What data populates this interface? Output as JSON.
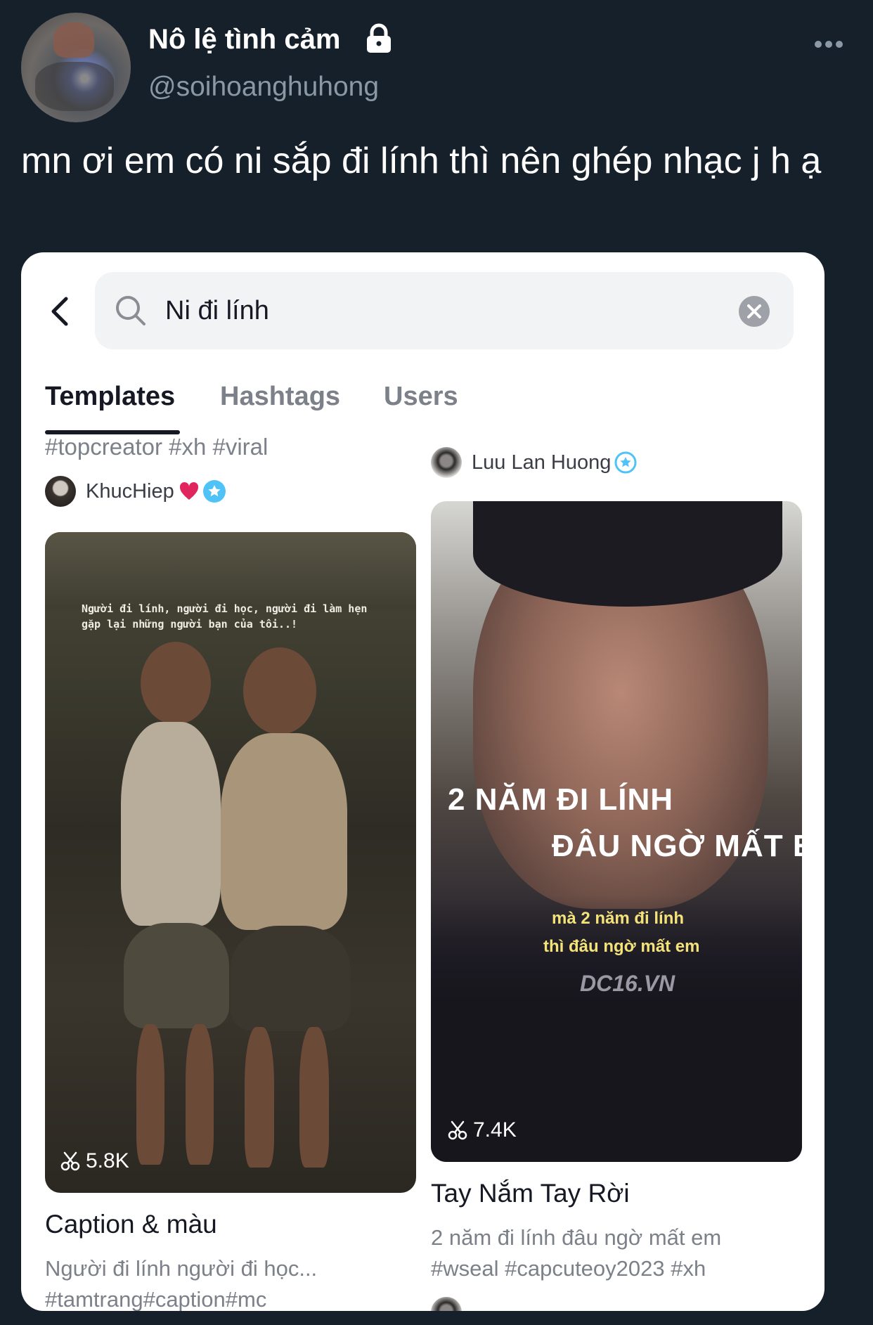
{
  "tweet": {
    "author_name": "Nô lệ tình cảm",
    "author_handle": "@soihoanghuhong",
    "text": "mn ơi em có ni sắp đi lính thì nên ghép nhạc j h ạ"
  },
  "embedded_app": {
    "search": {
      "value": "Ni đi lính"
    },
    "tabs": [
      {
        "label": "Templates",
        "active": true
      },
      {
        "label": "Hashtags",
        "active": false
      },
      {
        "label": "Users",
        "active": false
      }
    ],
    "results": {
      "left": {
        "top_hashtags": "#topcreator #xh #viral",
        "creator": "KhucHiep",
        "use_count": "5.8K",
        "thumbnail_caption": "Người đi lính, người đi học, người đi làm hẹn gặp lại những người bạn của tôi..!",
        "title": "Caption & màu",
        "desc_line1": "Người đi lính người đi học...",
        "desc_line2": "#tamtrang#caption#mc"
      },
      "right": {
        "creator": "Luu Lan Huong",
        "thumbnail_overlay": {
          "line1": "2 NĂM ĐI LÍNH",
          "line2": "ĐÂU NGỜ MẤT EM",
          "line3": "mà 2 năm đi lính",
          "line4": "thì đâu ngờ mất em",
          "watermark": "DC16.VN"
        },
        "use_count": "7.4K",
        "title": "Tay Nắm Tay Rời",
        "desc_line1": "2 năm đi lính đâu ngờ mất em",
        "desc_line2": "#wseal #capcuteoy2023 #xh"
      }
    }
  },
  "icons": {
    "lock": "lock-icon",
    "more": "more-horizontal-icon",
    "back": "chevron-left-icon",
    "search": "search-icon",
    "clear": "clear-circle-icon",
    "verified": "verified-badge-icon",
    "heart": "heart-icon",
    "scissors": "scissors-icon"
  },
  "colors": {
    "background": "#15202b",
    "handle": "#8b98a5",
    "verified": "#4fc3f7",
    "heart": "#e0245e"
  }
}
